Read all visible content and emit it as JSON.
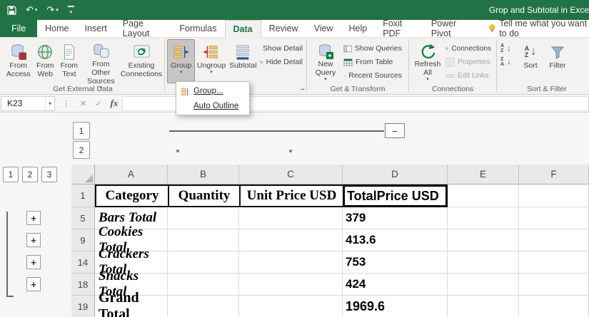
{
  "window": {
    "title": "Grop and Subtotal in Exce"
  },
  "icons": {
    "caret": "▾",
    "undo": "↶",
    "redo": "↷",
    "close": "✕",
    "check": "✓",
    "fx": "fx",
    "handle": "⋮",
    "plus": "+",
    "minus": "−",
    "arrow_down": "↓",
    "launcher": "⌐"
  },
  "tabs": {
    "items": [
      "File",
      "Home",
      "Insert",
      "Page Layout",
      "Formulas",
      "Data",
      "Review",
      "View",
      "Help",
      "Foxit PDF",
      "Power Pivot"
    ],
    "active": "Data",
    "tell_me": "Tell me what you want to do"
  },
  "ribbon": {
    "external": {
      "label": "Get External Data",
      "from_access": "From Access",
      "from_web": "From Web",
      "from_text": "From Text",
      "from_other": "From Other Sources",
      "existing": "Existing Connections"
    },
    "outline": {
      "group": "Group",
      "ungroup": "Ungroup",
      "subtotal": "Subtotal",
      "show_detail": "Show Detail",
      "hide_detail": "Hide Detail"
    },
    "transform": {
      "label": "Get & Transform",
      "new_query": "New Query",
      "show_queries": "Show Queries",
      "from_table": "From Table",
      "recent_sources": "Recent Sources"
    },
    "connections": {
      "label": "Connections",
      "refresh_all": "Refresh All",
      "connections": "Connections",
      "properties": "Properties",
      "edit_links": "Edit Links"
    },
    "sort_filter": {
      "label": "Sort & Filter",
      "sort": "Sort",
      "filter": "Filter",
      "letter_a": "A",
      "letter_z": "Z"
    }
  },
  "group_menu": {
    "items": [
      {
        "label": "Group..."
      },
      {
        "label": "Auto Outline"
      }
    ]
  },
  "formula_bar": {
    "name_box": "K23"
  },
  "sheet": {
    "col_levels": [
      "1",
      "2"
    ],
    "row_levels": [
      "1",
      "2",
      "3"
    ],
    "columns": [
      "A",
      "B",
      "C",
      "D",
      "E",
      "F"
    ],
    "rows": [
      {
        "num": "1",
        "a": "Category",
        "b": "Quantity",
        "c": "Unit Price USD",
        "d": "TotalPrice USD"
      },
      {
        "num": "5",
        "a": "Bars Total",
        "d": "379"
      },
      {
        "num": "9",
        "a": "Cookies Total",
        "d": "413.6"
      },
      {
        "num": "14",
        "a": "Crackers Total",
        "d": "753"
      },
      {
        "num": "18",
        "a": "Snacks Total",
        "d": "424"
      },
      {
        "num": "19",
        "a": "Grand Total",
        "d": "1969.6"
      }
    ]
  },
  "colors": {
    "accent": "#217346"
  }
}
